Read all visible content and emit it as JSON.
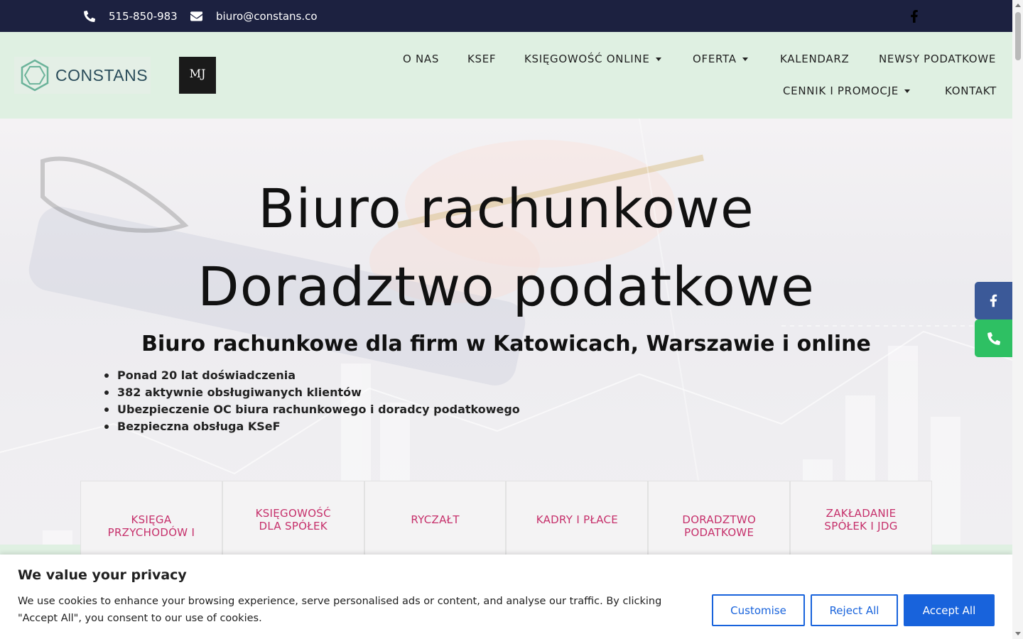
{
  "topbar": {
    "phone": "515-850-983",
    "email": "biuro@constans.co",
    "phone_icon": "phone-icon",
    "email_icon": "envelope-icon",
    "social_icon": "facebook-icon"
  },
  "header": {
    "logo_text": "CONSTANS",
    "partner_logo_text": "MJ",
    "nav": [
      {
        "label": "O NAS"
      },
      {
        "label": "KSEF"
      },
      {
        "label": "KSIĘGOWOŚĆ ONLINE"
      },
      {
        "label": "OFERTA"
      },
      {
        "label": "KALENDARZ"
      },
      {
        "label": "NEWSY PODATKOWE"
      },
      {
        "label": "CENNIK I PROMOCJE"
      },
      {
        "label": "KONTAKT"
      }
    ]
  },
  "hero": {
    "title_line1": "Biuro rachunkowe",
    "title_line2": "Doradztwo podatkowe",
    "subtitle": "Biuro rachunkowe dla firm w Katowicach, Warszawie i online",
    "bullets": [
      "Ponad 20 lat doświadczenia",
      "382 aktywnie obsługiwanych klientów",
      "Ubezpieczenie OC biura rachunkowego i doradcy podatkowego",
      "Bezpieczna obsługa KSeF"
    ]
  },
  "services": [
    {
      "label": "KSIĘGA PRZYCHODÓW I ROZCHODÓW"
    },
    {
      "label": "KSIĘGOWOŚĆ DLA SPÓŁEK"
    },
    {
      "label": "RYCZAŁT"
    },
    {
      "label": "KADRY I PŁACE"
    },
    {
      "label": "DORADZTWO PODATKOWE CONSULTING"
    },
    {
      "label": "ZAKŁADANIE SPÓŁEK I JDG"
    }
  ],
  "side_buttons": {
    "facebook_icon": "facebook-icon",
    "phone_icon": "phone-icon"
  },
  "cookie": {
    "title": "We value your privacy",
    "text": "We use cookies to enhance your browsing experience, serve personalised ads or content, and analyse our traffic. By clicking \"Accept All\", you consent to our use of cookies.",
    "customise": "Customise",
    "reject": "Reject All",
    "accept": "Accept All"
  },
  "colors": {
    "topbar": "#1c2140",
    "header": "#dff0e2",
    "accent_pink": "#c6306b",
    "cookie_blue": "#1863dc",
    "facebook_blue": "#3b5998",
    "phone_green": "#2ec063"
  }
}
